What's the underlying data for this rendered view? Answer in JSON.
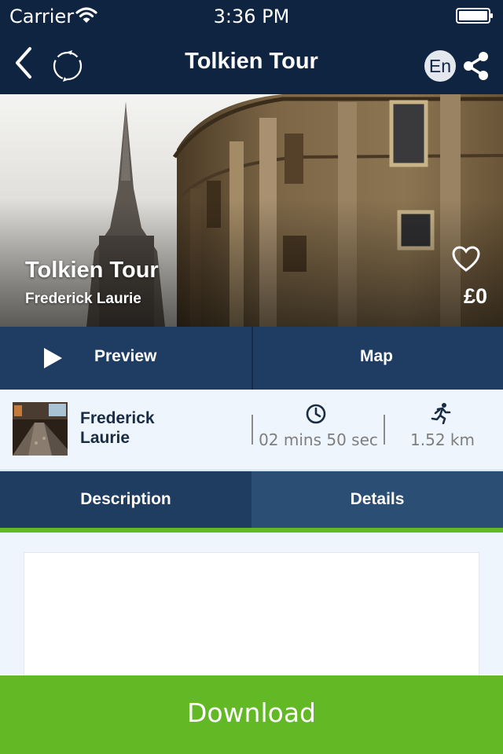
{
  "status_bar": {
    "carrier": "Carrier",
    "time": "3:36 PM"
  },
  "nav": {
    "title": "Tolkien Tour",
    "language": "En"
  },
  "hero": {
    "title": "Tolkien Tour",
    "author": "Frederick Laurie",
    "price": "£0"
  },
  "actions": {
    "preview_label": "Preview",
    "map_label": "Map"
  },
  "info": {
    "author_name": "Frederick Laurie",
    "duration": "02 mins 50 sec",
    "distance": "1.52 km"
  },
  "tabs": [
    {
      "label": "Description",
      "selected": true
    },
    {
      "label": "Details",
      "selected": false
    }
  ],
  "download_label": "Download",
  "colors": {
    "nav_bg": "#0f2440",
    "action_bg": "#1f3d63",
    "accent_green": "#63b825",
    "page_bg": "#eef5fc"
  },
  "icons": [
    "wifi-icon",
    "battery-icon",
    "back-icon",
    "refresh-icon",
    "share-icon",
    "heart-icon",
    "play-icon",
    "clock-icon",
    "runner-icon"
  ]
}
